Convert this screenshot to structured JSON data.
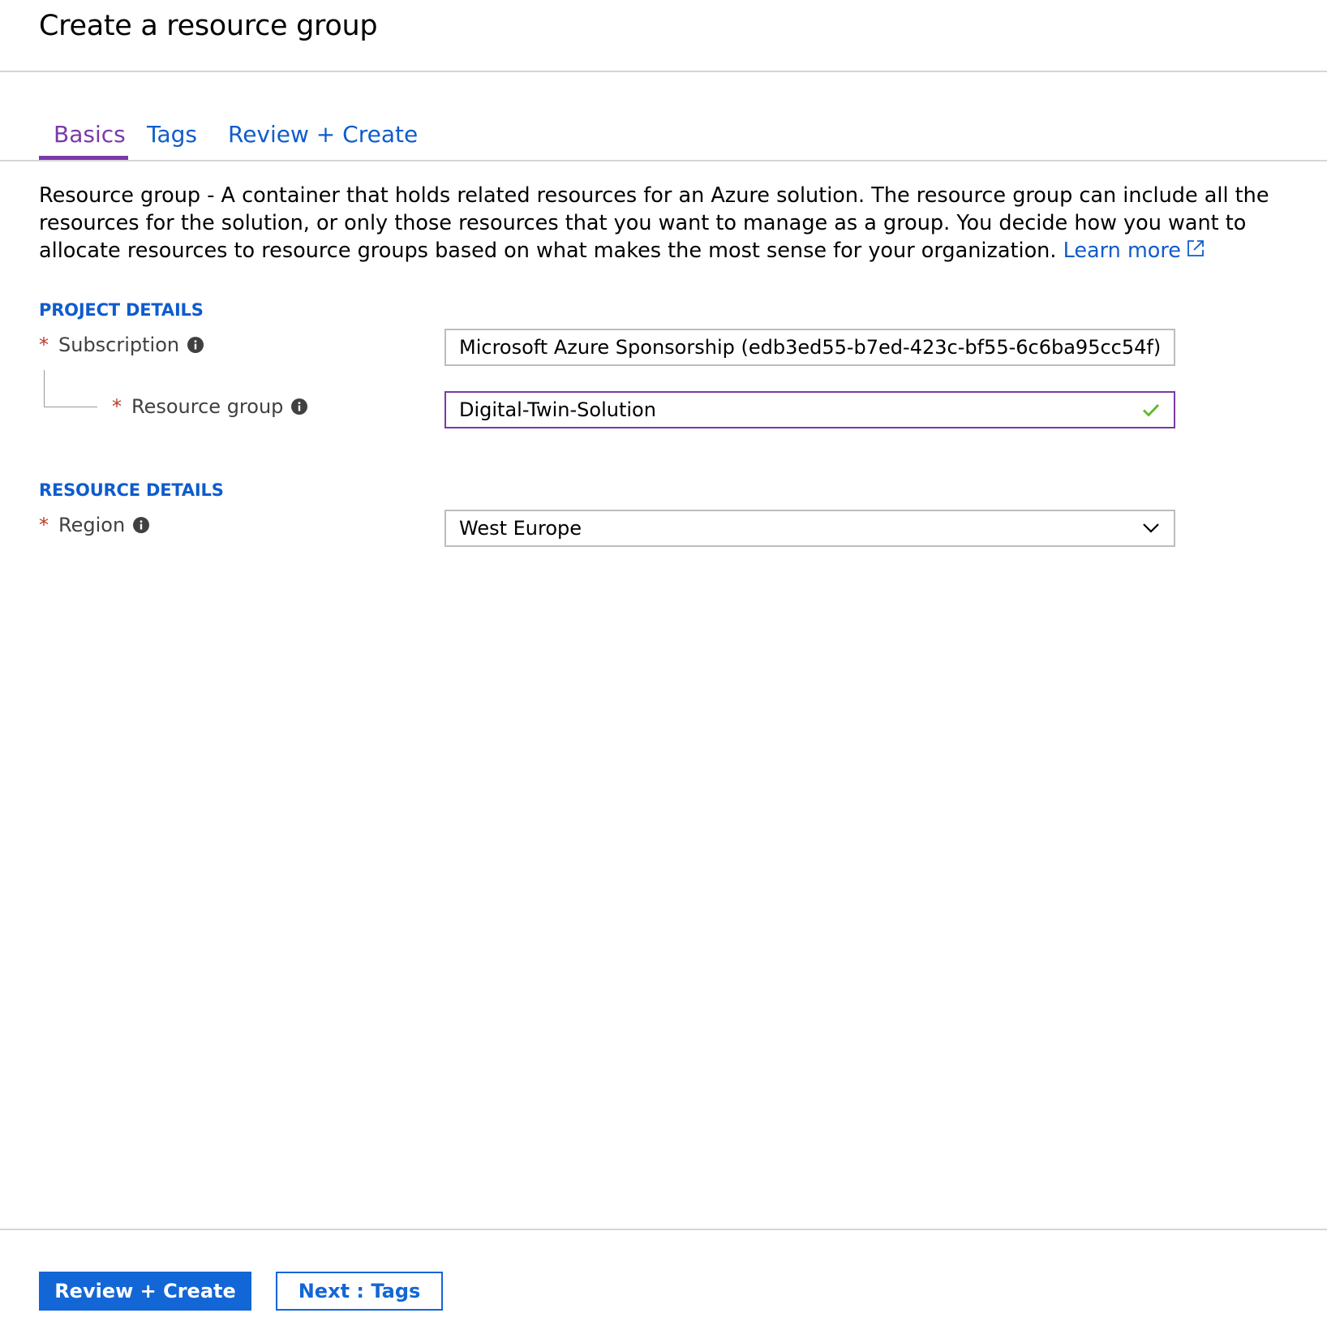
{
  "header": {
    "title": "Create a resource group"
  },
  "tabs": [
    {
      "label": "Basics",
      "active": true
    },
    {
      "label": "Tags",
      "active": false
    },
    {
      "label": "Review + Create",
      "active": false
    }
  ],
  "description": {
    "lead": "Resource group",
    "line1_rest": " - A container that holds related resources for an Azure solution. The resource group can include all the",
    "line2": "resources for the solution, or only those resources that you want to manage as a group. You decide how you want to",
    "line3": "allocate resources to resource groups based on what makes the most sense for your organization.",
    "learn_more": "Learn more",
    "learn_more_icon": "external-link-icon"
  },
  "project_details": {
    "heading": "PROJECT DETAILS",
    "subscription": {
      "label": "Subscription",
      "required": "*",
      "value": "Microsoft Azure Sponsorship (edb3ed55-b7ed-423c-bf55-6c6ba95cc54f)",
      "icon": "chevron-down-icon"
    },
    "resource_group": {
      "label": "Resource group",
      "required": "*",
      "value": "Digital-Twin-Solution",
      "icon": "checkmark-icon",
      "valid_color": "#5cb82a"
    }
  },
  "resource_details": {
    "heading": "RESOURCE DETAILS",
    "region": {
      "label": "Region",
      "required": "*",
      "value": "West Europe",
      "icon": "chevron-down-icon"
    }
  },
  "footer": {
    "primary_button": "Review + Create",
    "secondary_button": "Next : Tags"
  },
  "colors": {
    "accent_purple": "#7a3aa7",
    "link_blue": "#0f5ccc",
    "button_blue": "#1366d6",
    "required_red": "#c0392b"
  }
}
